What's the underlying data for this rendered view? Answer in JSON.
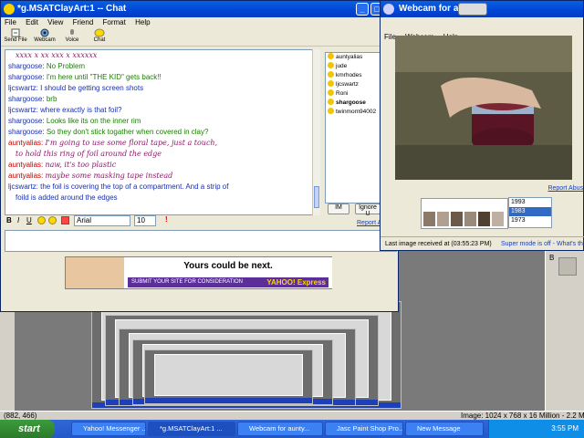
{
  "chat_window": {
    "title": "*g.MSATClayArt:1 -- Chat",
    "menu": [
      "File",
      "Edit",
      "View",
      "Friend",
      "Format",
      "Help"
    ],
    "toolbar": [
      "Send File",
      "Webcam",
      "Voice",
      "Chat"
    ],
    "messages": [
      {
        "name": "",
        "text": "xxxx x xx xxx x xxxxxx",
        "style": "cut"
      },
      {
        "name": "shargoose:",
        "text": "No Problem",
        "style": "sg"
      },
      {
        "name": "shargoose:",
        "text": "I'm here until \"THE KID\" gets back!!",
        "style": "sg"
      },
      {
        "name": "ljcswartz:",
        "text": "I should be getting screen shots",
        "style": "lj"
      },
      {
        "name": "shargoose:",
        "text": "brb",
        "style": "sg"
      },
      {
        "name": "ljcswartz:",
        "text": "where exactly is that foil?",
        "style": "lj"
      },
      {
        "name": "shargoose:",
        "text": "Looks like its on the inner rim",
        "style": "sg"
      },
      {
        "name": "shargoose:",
        "text": "So they don't stick togather when covered in clay?",
        "style": "sg"
      },
      {
        "name": "auntyalias:",
        "text": "I'm going to use some floral tape, just a touch,",
        "style": "au"
      },
      {
        "name": "",
        "text": "to hold this ring of foil around the edge",
        "style": "au"
      },
      {
        "name": "auntyalias:",
        "text": "naw, it's too plastic",
        "style": "au"
      },
      {
        "name": "auntyalias:",
        "text": "maybe some masking tape instead",
        "style": "au"
      },
      {
        "name": "ljcswartz:",
        "text": "the foil is covering the top of a compartment. And a strip of",
        "style": "lj"
      },
      {
        "name": "",
        "text": "foild is added around the edges",
        "style": "lj"
      }
    ],
    "users": [
      "auntyalias",
      "jude",
      "kmrhodes",
      "ljcswartz",
      "Roni",
      "shargoose",
      "twinmom94002"
    ],
    "buttons": {
      "im": "IM",
      "ignore": "Ignore U",
      "report": "Report A"
    },
    "format_bar": {
      "font": "Arial",
      "size": "10"
    },
    "ad": {
      "headline": "Yours could be next.",
      "strip": "SUBMIT YOUR SITE FOR CONSIDERATION",
      "brand": "YAHOO! Express"
    }
  },
  "webcam_window": {
    "title": "Webcam for aunty",
    "menu": [
      "File",
      "Webcam",
      "Help"
    ],
    "report": "Report Abus",
    "years": [
      "1993",
      "1983",
      "1973"
    ],
    "selected_year": "1983",
    "status_left": "Last image received at (03:55:23 PM)",
    "status_right": "Super mode is off - What's this"
  },
  "background": {
    "coords": "(882, 466)",
    "image_info": "Image:  1024 x 768 x 16 Million - 2.2 MBytes",
    "side_label": "B"
  },
  "taskbar": {
    "start": "start",
    "tasks": [
      "Yahoo! Messenger ...",
      "*g.MSATClayArt:1 ...",
      "Webcam for aunty...",
      "Jasc Paint Shop Pro...",
      "New Message"
    ],
    "clock": "3:55 PM"
  },
  "colors": {
    "title_blue": "#0045d6",
    "taskbar_blue": "#2457c9",
    "start_green": "#3b9c3b"
  }
}
